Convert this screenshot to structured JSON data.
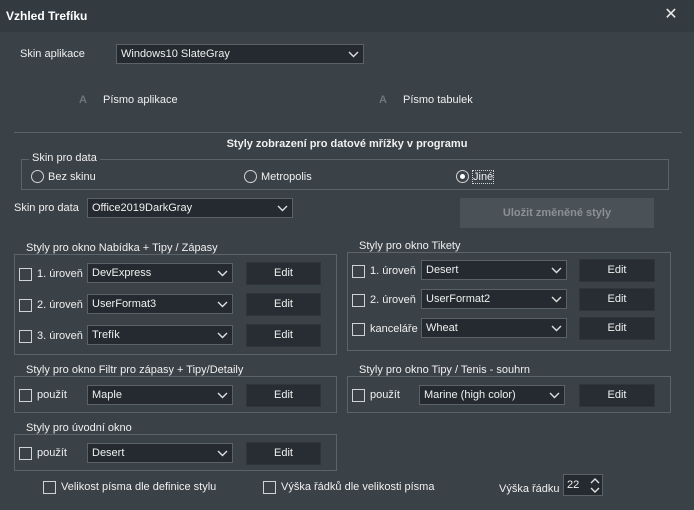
{
  "window": {
    "title": "Vzhled Trefíku",
    "close_glyph": "✕"
  },
  "app_skin": {
    "label": "Skin aplikace",
    "value": "Windows10 SlateGray"
  },
  "fonts": {
    "app_font_label": "Písmo aplikace",
    "table_font_label": "Písmo tabulek",
    "icon_glyph": "A"
  },
  "grid_styles": {
    "header": "Styly zobrazení pro datové mřížky v programu",
    "skin_group_title": "Skin pro data",
    "radios": [
      {
        "label": "Bez skinu",
        "selected": false
      },
      {
        "label": "Metropolis",
        "selected": false
      },
      {
        "label": "Jiné",
        "selected": true
      }
    ],
    "skin_label": "Skin pro data",
    "skin_value": "Office2019DarkGray",
    "save_button": "Uložit změněné styly"
  },
  "groups": {
    "nabidka": {
      "title": "Styly pro okno Nabídka + Tipy / Zápasy",
      "rows": [
        {
          "label": "1. úroveň",
          "value": "DevExpress",
          "edit": "Edit"
        },
        {
          "label": "2. úroveň",
          "value": "UserFormat3",
          "edit": "Edit"
        },
        {
          "label": "3. úroveň",
          "value": "Trefík",
          "edit": "Edit"
        }
      ]
    },
    "tikety": {
      "title": "Styly pro okno Tikety",
      "rows": [
        {
          "label": "1. úroveň",
          "value": "Desert",
          "edit": "Edit"
        },
        {
          "label": "2. úroveň",
          "value": "UserFormat2",
          "edit": "Edit"
        },
        {
          "label": "kanceláře",
          "value": "Wheat",
          "edit": "Edit"
        }
      ]
    },
    "filtr": {
      "title": "Styly pro okno Filtr pro zápasy + Tipy/Detaily",
      "rows": [
        {
          "label": "použít",
          "value": "Maple",
          "edit": "Edit"
        }
      ]
    },
    "tenis": {
      "title": "Styly pro okno Tipy / Tenis - souhrn",
      "rows": [
        {
          "label": "použít",
          "value": "Marine (high color)",
          "edit": "Edit"
        }
      ]
    },
    "uvodni": {
      "title": "Styly pro úvodní okno",
      "rows": [
        {
          "label": "použít",
          "value": "Desert",
          "edit": "Edit"
        }
      ]
    }
  },
  "footer": {
    "font_size_label": "Velikost písma dle definice stylu",
    "row_height_by_font_label": "Výška řádků dle velikosti písma",
    "row_height_label": "Výška řádku",
    "row_height_value": "22"
  },
  "colors": {
    "background": "#3a4147",
    "control": "#242a2f",
    "border": "#5c6469"
  }
}
